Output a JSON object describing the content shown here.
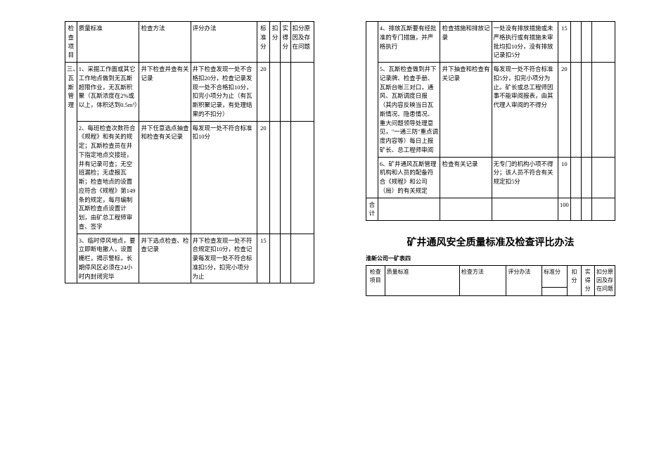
{
  "left_table": {
    "header": {
      "item": "检查项目",
      "std": "质量标准",
      "method": "检查方法",
      "scoring": "评分办法",
      "score": "标准分",
      "deduct": "扣分",
      "actual": "实得分",
      "reason": "扣分原因及存在问题"
    },
    "section_label": "三、瓦斯管理",
    "rows": [
      {
        "std": "1、采掘工作面或其它工作地点做到无瓦斯超限作业，无瓦斯积聚（瓦斯浓度在2%或以上，体积达到0.5m³）",
        "method": "井下检查并查有关记录",
        "scoring": "井下检查发现一处不合格扣20分，检查记录发现一处不合格扣10分，扣完小项分为止（有瓦斯积聚记录，有处理结果的不扣分）",
        "score": "20"
      },
      {
        "std": "2、每班检查次数符合《规程》和有关的规定；瓦斯检查员在井下指定地点交接班，井有记录可查；无空班漏检；无虚报瓦斯；检查地点的设置应符合《规程》第149条的规定，每月编制瓦斯检查点设置计划，由矿总工程师审查、签字",
        "method": "井下任意选点抽查和检查有关记录",
        "scoring": "每发现一处不符合标准扣10分",
        "score": "20"
      },
      {
        "std": "3、临时停风地点，要立即断电撤人，设置栅栏，揭示警标，长期停风区必须在24小时内封闭完毕",
        "method": "井下选点检查、检查记录",
        "scoring": "井下检查发现一处不符合规定扣10分，检查记录每发现一处不符合标准扣5分，扣完小项分为止",
        "score": "15"
      }
    ]
  },
  "right_table_top": {
    "rows": [
      {
        "std": "4、排放瓦斯要有经批准的专门措施，并严格执行",
        "method": "检查措施和排放记录",
        "scoring": "一处没有排放措施或未严格执行或有措施未审批均扣10分，没有排放记录扣5分",
        "score": "15"
      },
      {
        "std": "5、瓦斯检查做到井下记录牌、检查手册、瓦斯台帐三对口，通风、瓦斯调度日报（其内容反映当日瓦斯情况、隐患情况、重大问题领导处理意见，\"一通三防\"重点调度内容等）每日上报矿长、总工程师审阅",
        "method": "井下抽查和检查有关记录",
        "scoring": "每发现一处不符合标准扣5分，扣完小项分为止。矿长或总工程师因事不能审阅报表，由其代理人审阅的不得分",
        "score": "20"
      },
      {
        "std": "6、矿井通风瓦斯管理机构和人员的配备符合《规程》和公司（局）的有关规定",
        "method": "检查有关记录",
        "scoring": "无专门的机构小项不得分；该人员不符合有关规定扣5分",
        "score": "10"
      }
    ],
    "total_label": "合计",
    "total_score": "100"
  },
  "heading": "矿井通风安全质量标准及检查评比办法",
  "subheading": "淮新公司一矿表四",
  "table2_header": {
    "item": "检查项目",
    "std": "质量标准",
    "method": "检查方法",
    "scoring": "评分办法",
    "score": "标准分",
    "deduct": "扣分",
    "actual": "实得分",
    "reason": "扣分原因及存在问题"
  }
}
